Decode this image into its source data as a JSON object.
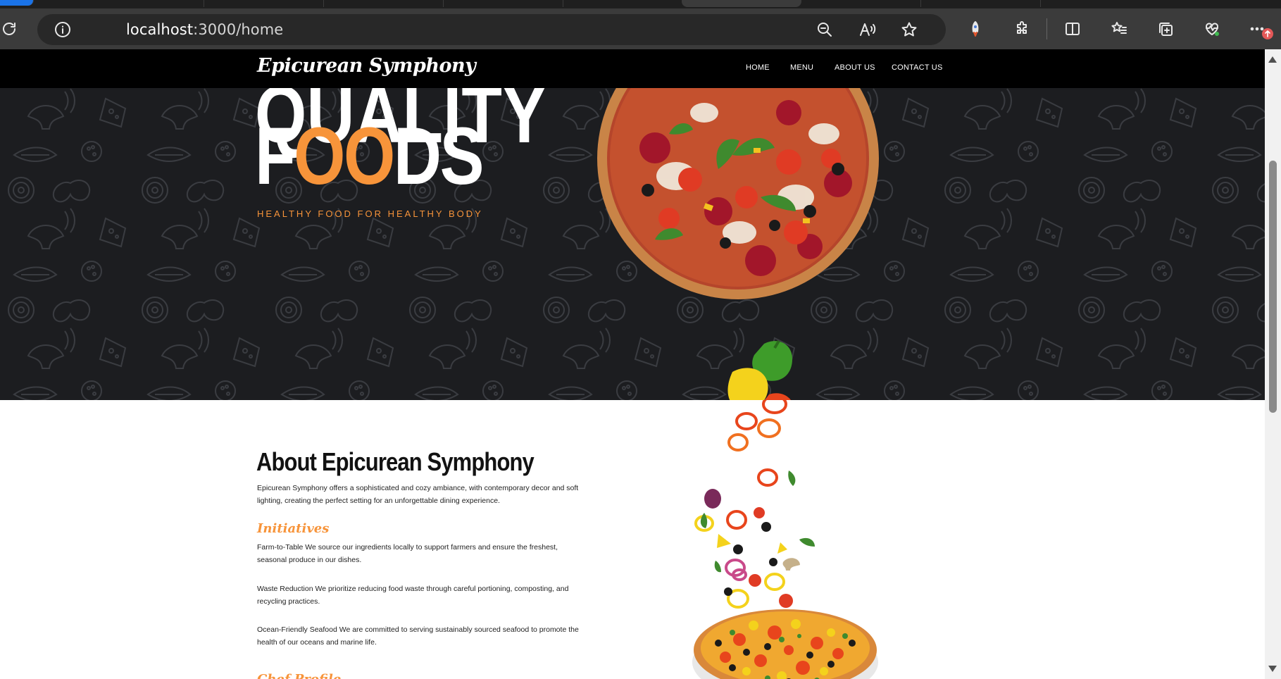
{
  "browser": {
    "url_host": "localhost",
    "url_path": ":3000/home"
  },
  "nav": {
    "brand": "Epicurean Symphony",
    "links": [
      "HOME",
      "MENU",
      "ABOUT US",
      "CONTACT US"
    ]
  },
  "hero": {
    "title_start": "F",
    "title_accent": "OO",
    "title_end": "DS",
    "title_cut": "QUALITY",
    "tagline": "HEALTHY FOOD FOR HEALTHY BODY"
  },
  "about": {
    "title": "About Epicurean Symphony",
    "description": "Epicurean Symphony offers a sophisticated and cozy ambiance, with contemporary decor and soft lighting, creating the perfect setting for an unforgettable dining experience.",
    "initiatives_heading": "Initiatives",
    "initiatives": [
      "Farm-to-Table We source our ingredients locally to support farmers and ensure the freshest, seasonal produce in our dishes.",
      "Waste Reduction We prioritize reducing food waste through careful portioning, composting, and recycling practices.",
      "Ocean-Friendly Seafood We are committed to serving sustainably sourced seafood to promote the health of our oceans and marine life."
    ],
    "next_heading": "Chef Profile"
  },
  "colors": {
    "accent": "#f7943a",
    "hero_bg": "#1c1d20",
    "nav_bg": "#000000"
  }
}
